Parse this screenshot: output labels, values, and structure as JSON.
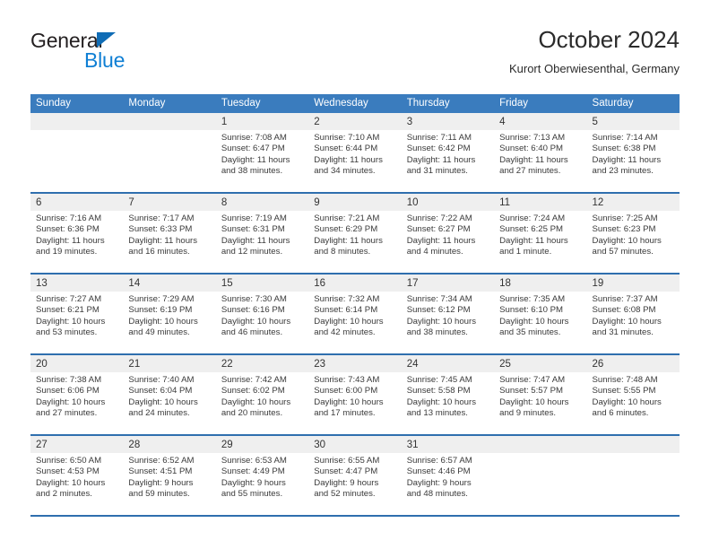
{
  "brand": {
    "name_part1": "General",
    "name_part2": "Blue",
    "triangle_icon": "triangle-icon",
    "colors": {
      "blue": "#0f7fd4",
      "triangle": "#0f6cb5",
      "dark": "#231f20"
    }
  },
  "header": {
    "title": "October 2024",
    "subtitle": "Kurort Oberwiesenthal, Germany"
  },
  "theme": {
    "header_bg": "#3a7cbe",
    "week_divider": "#2f6fae",
    "daynum_band": "#efefef"
  },
  "weekdays": [
    "Sunday",
    "Monday",
    "Tuesday",
    "Wednesday",
    "Thursday",
    "Friday",
    "Saturday"
  ],
  "weeks": [
    [
      {
        "day": "",
        "sunrise": "",
        "sunset": "",
        "daylight_line1": "",
        "daylight_line2": "",
        "empty": true
      },
      {
        "day": "",
        "sunrise": "",
        "sunset": "",
        "daylight_line1": "",
        "daylight_line2": "",
        "empty": true
      },
      {
        "day": "1",
        "sunrise": "Sunrise: 7:08 AM",
        "sunset": "Sunset: 6:47 PM",
        "daylight_line1": "Daylight: 11 hours",
        "daylight_line2": "and 38 minutes."
      },
      {
        "day": "2",
        "sunrise": "Sunrise: 7:10 AM",
        "sunset": "Sunset: 6:44 PM",
        "daylight_line1": "Daylight: 11 hours",
        "daylight_line2": "and 34 minutes."
      },
      {
        "day": "3",
        "sunrise": "Sunrise: 7:11 AM",
        "sunset": "Sunset: 6:42 PM",
        "daylight_line1": "Daylight: 11 hours",
        "daylight_line2": "and 31 minutes."
      },
      {
        "day": "4",
        "sunrise": "Sunrise: 7:13 AM",
        "sunset": "Sunset: 6:40 PM",
        "daylight_line1": "Daylight: 11 hours",
        "daylight_line2": "and 27 minutes."
      },
      {
        "day": "5",
        "sunrise": "Sunrise: 7:14 AM",
        "sunset": "Sunset: 6:38 PM",
        "daylight_line1": "Daylight: 11 hours",
        "daylight_line2": "and 23 minutes."
      }
    ],
    [
      {
        "day": "6",
        "sunrise": "Sunrise: 7:16 AM",
        "sunset": "Sunset: 6:36 PM",
        "daylight_line1": "Daylight: 11 hours",
        "daylight_line2": "and 19 minutes."
      },
      {
        "day": "7",
        "sunrise": "Sunrise: 7:17 AM",
        "sunset": "Sunset: 6:33 PM",
        "daylight_line1": "Daylight: 11 hours",
        "daylight_line2": "and 16 minutes."
      },
      {
        "day": "8",
        "sunrise": "Sunrise: 7:19 AM",
        "sunset": "Sunset: 6:31 PM",
        "daylight_line1": "Daylight: 11 hours",
        "daylight_line2": "and 12 minutes."
      },
      {
        "day": "9",
        "sunrise": "Sunrise: 7:21 AM",
        "sunset": "Sunset: 6:29 PM",
        "daylight_line1": "Daylight: 11 hours",
        "daylight_line2": "and 8 minutes."
      },
      {
        "day": "10",
        "sunrise": "Sunrise: 7:22 AM",
        "sunset": "Sunset: 6:27 PM",
        "daylight_line1": "Daylight: 11 hours",
        "daylight_line2": "and 4 minutes."
      },
      {
        "day": "11",
        "sunrise": "Sunrise: 7:24 AM",
        "sunset": "Sunset: 6:25 PM",
        "daylight_line1": "Daylight: 11 hours",
        "daylight_line2": "and 1 minute."
      },
      {
        "day": "12",
        "sunrise": "Sunrise: 7:25 AM",
        "sunset": "Sunset: 6:23 PM",
        "daylight_line1": "Daylight: 10 hours",
        "daylight_line2": "and 57 minutes."
      }
    ],
    [
      {
        "day": "13",
        "sunrise": "Sunrise: 7:27 AM",
        "sunset": "Sunset: 6:21 PM",
        "daylight_line1": "Daylight: 10 hours",
        "daylight_line2": "and 53 minutes."
      },
      {
        "day": "14",
        "sunrise": "Sunrise: 7:29 AM",
        "sunset": "Sunset: 6:19 PM",
        "daylight_line1": "Daylight: 10 hours",
        "daylight_line2": "and 49 minutes."
      },
      {
        "day": "15",
        "sunrise": "Sunrise: 7:30 AM",
        "sunset": "Sunset: 6:16 PM",
        "daylight_line1": "Daylight: 10 hours",
        "daylight_line2": "and 46 minutes."
      },
      {
        "day": "16",
        "sunrise": "Sunrise: 7:32 AM",
        "sunset": "Sunset: 6:14 PM",
        "daylight_line1": "Daylight: 10 hours",
        "daylight_line2": "and 42 minutes."
      },
      {
        "day": "17",
        "sunrise": "Sunrise: 7:34 AM",
        "sunset": "Sunset: 6:12 PM",
        "daylight_line1": "Daylight: 10 hours",
        "daylight_line2": "and 38 minutes."
      },
      {
        "day": "18",
        "sunrise": "Sunrise: 7:35 AM",
        "sunset": "Sunset: 6:10 PM",
        "daylight_line1": "Daylight: 10 hours",
        "daylight_line2": "and 35 minutes."
      },
      {
        "day": "19",
        "sunrise": "Sunrise: 7:37 AM",
        "sunset": "Sunset: 6:08 PM",
        "daylight_line1": "Daylight: 10 hours",
        "daylight_line2": "and 31 minutes."
      }
    ],
    [
      {
        "day": "20",
        "sunrise": "Sunrise: 7:38 AM",
        "sunset": "Sunset: 6:06 PM",
        "daylight_line1": "Daylight: 10 hours",
        "daylight_line2": "and 27 minutes."
      },
      {
        "day": "21",
        "sunrise": "Sunrise: 7:40 AM",
        "sunset": "Sunset: 6:04 PM",
        "daylight_line1": "Daylight: 10 hours",
        "daylight_line2": "and 24 minutes."
      },
      {
        "day": "22",
        "sunrise": "Sunrise: 7:42 AM",
        "sunset": "Sunset: 6:02 PM",
        "daylight_line1": "Daylight: 10 hours",
        "daylight_line2": "and 20 minutes."
      },
      {
        "day": "23",
        "sunrise": "Sunrise: 7:43 AM",
        "sunset": "Sunset: 6:00 PM",
        "daylight_line1": "Daylight: 10 hours",
        "daylight_line2": "and 17 minutes."
      },
      {
        "day": "24",
        "sunrise": "Sunrise: 7:45 AM",
        "sunset": "Sunset: 5:58 PM",
        "daylight_line1": "Daylight: 10 hours",
        "daylight_line2": "and 13 minutes."
      },
      {
        "day": "25",
        "sunrise": "Sunrise: 7:47 AM",
        "sunset": "Sunset: 5:57 PM",
        "daylight_line1": "Daylight: 10 hours",
        "daylight_line2": "and 9 minutes."
      },
      {
        "day": "26",
        "sunrise": "Sunrise: 7:48 AM",
        "sunset": "Sunset: 5:55 PM",
        "daylight_line1": "Daylight: 10 hours",
        "daylight_line2": "and 6 minutes."
      }
    ],
    [
      {
        "day": "27",
        "sunrise": "Sunrise: 6:50 AM",
        "sunset": "Sunset: 4:53 PM",
        "daylight_line1": "Daylight: 10 hours",
        "daylight_line2": "and 2 minutes."
      },
      {
        "day": "28",
        "sunrise": "Sunrise: 6:52 AM",
        "sunset": "Sunset: 4:51 PM",
        "daylight_line1": "Daylight: 9 hours",
        "daylight_line2": "and 59 minutes."
      },
      {
        "day": "29",
        "sunrise": "Sunrise: 6:53 AM",
        "sunset": "Sunset: 4:49 PM",
        "daylight_line1": "Daylight: 9 hours",
        "daylight_line2": "and 55 minutes."
      },
      {
        "day": "30",
        "sunrise": "Sunrise: 6:55 AM",
        "sunset": "Sunset: 4:47 PM",
        "daylight_line1": "Daylight: 9 hours",
        "daylight_line2": "and 52 minutes."
      },
      {
        "day": "31",
        "sunrise": "Sunrise: 6:57 AM",
        "sunset": "Sunset: 4:46 PM",
        "daylight_line1": "Daylight: 9 hours",
        "daylight_line2": "and 48 minutes."
      },
      {
        "day": "",
        "sunrise": "",
        "sunset": "",
        "daylight_line1": "",
        "daylight_line2": "",
        "empty": true
      },
      {
        "day": "",
        "sunrise": "",
        "sunset": "",
        "daylight_line1": "",
        "daylight_line2": "",
        "empty": true
      }
    ]
  ]
}
